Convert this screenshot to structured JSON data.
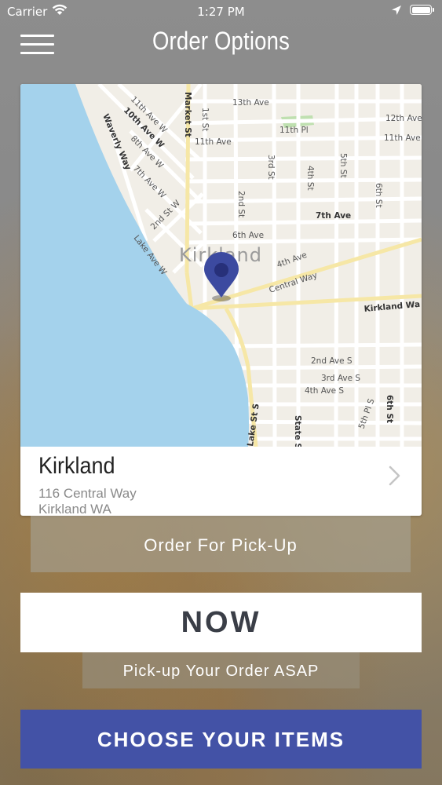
{
  "status_bar": {
    "carrier": "Carrier",
    "time": "1:27 PM"
  },
  "header": {
    "title": "Order Options",
    "menu_icon": "hamburger-menu-icon"
  },
  "location": {
    "name": "Kirkland",
    "address_line1": "116 Central Way",
    "address_line2": "Kirkland WA",
    "chevron_icon": "chevron-right-icon"
  },
  "map": {
    "city_label": "Kirkland",
    "street_labels": [
      "11th Ave W",
      "10th Ave W",
      "Market St",
      "13th Ave",
      "12th Ave",
      "1st St",
      "11th Ave",
      "11th Pl",
      "11th Ave",
      "Waverly Way",
      "8th Ave W",
      "7th Ave W",
      "2nd St W",
      "3rd St",
      "2nd St",
      "4th St",
      "5th St",
      "6th St",
      "7th Ave",
      "6th Ave",
      "Lake Ave W",
      "4th Ave",
      "Central Way",
      "Kirkland Wa",
      "2nd Ave S",
      "3rd Ave S",
      "4th Ave S",
      "5th Pl S",
      "6th St",
      "Lake St S",
      "State St S"
    ],
    "pin_icon": "map-pin-icon"
  },
  "actions": {
    "pickup_label": "Order For Pick-Up",
    "now_label": "NOW",
    "asap_label": "Pick-up Your Order ASAP",
    "choose_label": "CHOOSE YOUR ITEMS"
  },
  "colors": {
    "primary_button": "#4352a6",
    "water": "#a4d2ec",
    "map_land": "#f1eee7",
    "pin": "#3c4aa0"
  }
}
